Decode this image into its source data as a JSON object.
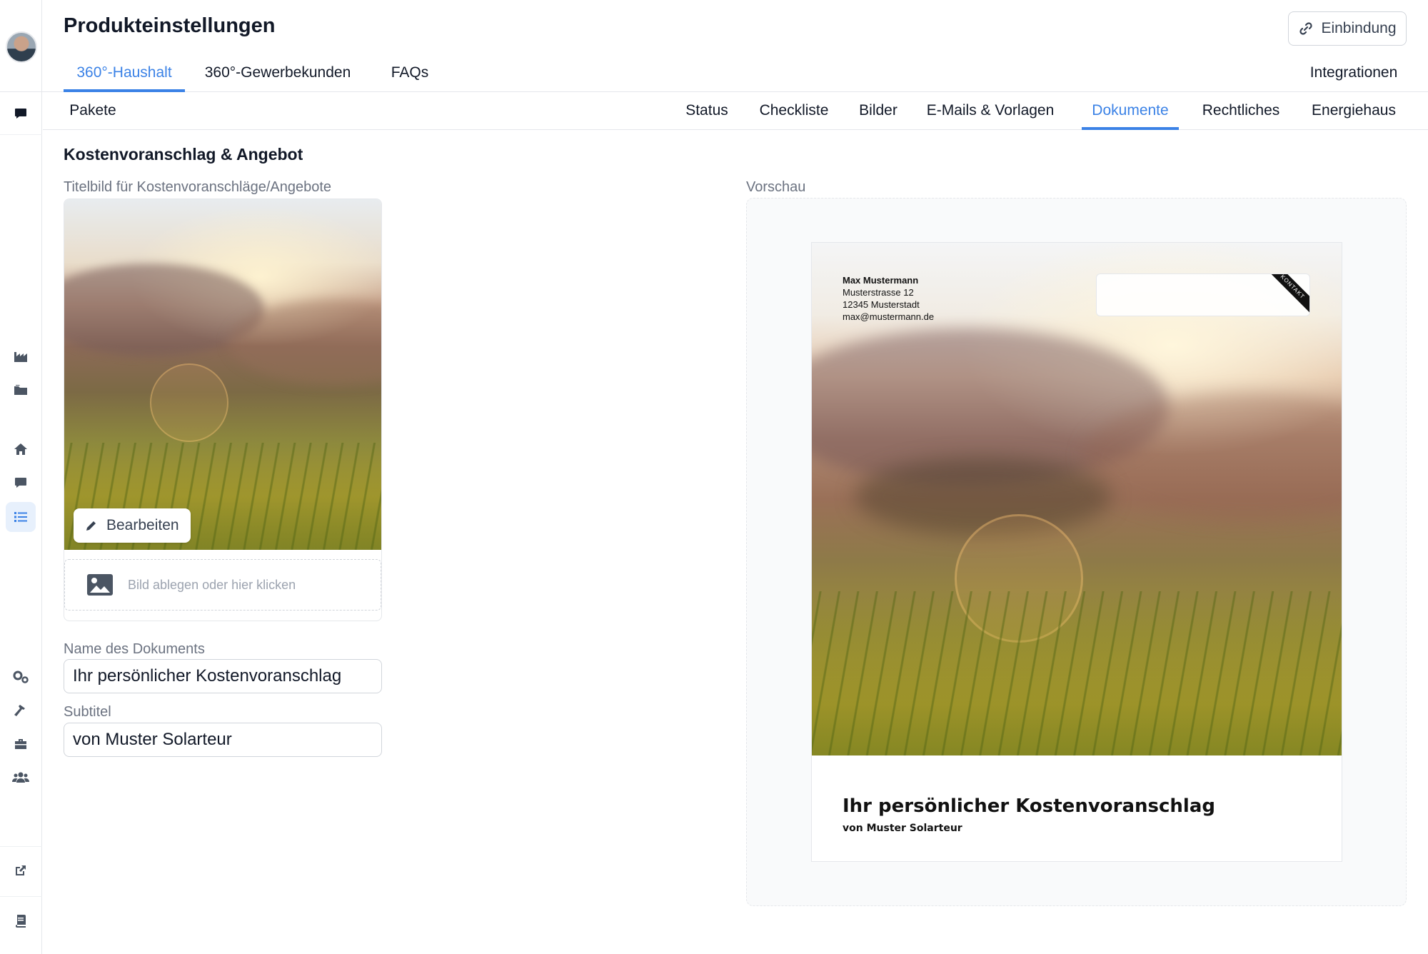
{
  "header": {
    "title": "Produkteinstellungen",
    "embed_button_label": "Einbindung"
  },
  "tabs_primary": [
    {
      "label": "360°-Haushalt",
      "active": true
    },
    {
      "label": "360°-Gewerbekunden",
      "active": false
    },
    {
      "label": "FAQs",
      "active": false
    },
    {
      "label": "Integrationen",
      "active": false
    }
  ],
  "tabs_secondary": [
    {
      "label": "Pakete",
      "active": false
    },
    {
      "label": "Status",
      "active": false
    },
    {
      "label": "Checkliste",
      "active": false
    },
    {
      "label": "Bilder",
      "active": false
    },
    {
      "label": "E-Mails & Vorlagen",
      "active": false
    },
    {
      "label": "Dokumente",
      "active": true
    },
    {
      "label": "Rechtliches",
      "active": false
    },
    {
      "label": "Energiehaus",
      "active": false
    }
  ],
  "sidebar": {
    "items": [
      {
        "icon": "chat-icon",
        "active": false
      },
      {
        "icon": "factory-icon",
        "active": false
      },
      {
        "icon": "folder-icon",
        "active": false
      },
      {
        "icon": "home-icon",
        "active": false
      },
      {
        "icon": "message-icon",
        "active": false
      },
      {
        "icon": "list-icon",
        "active": true
      },
      {
        "icon": "gears-icon",
        "active": false
      },
      {
        "icon": "hammer-icon",
        "active": false
      },
      {
        "icon": "toolbox-icon",
        "active": false
      },
      {
        "icon": "users-icon",
        "active": false
      },
      {
        "icon": "external-link-icon",
        "active": false
      },
      {
        "icon": "book-icon",
        "active": false
      }
    ]
  },
  "section": {
    "title": "Kostenvoranschlag & Angebot",
    "cover_image_label": "Titelbild für Kostenvoranschläge/Angebote",
    "edit_button_label": "Bearbeiten",
    "dropzone_text": "Bild ablegen oder hier klicken",
    "doc_name_label": "Name des Dokuments",
    "doc_name_value": "Ihr persönlicher Kostenvoranschlag",
    "subtitle_label": "Subtitel",
    "subtitle_value": "von Muster Solarteur"
  },
  "preview": {
    "label": "Vorschau",
    "address_name": "Max Mustermann",
    "address_street": "Musterstrasse 12",
    "address_city": "12345 Musterstadt",
    "address_email": "max@mustermann.de",
    "ribbon_text": "KONTAKT",
    "title": "Ihr persönlicher Kostenvoranschlag",
    "subtitle": "von Muster Solarteur"
  },
  "colors": {
    "accent": "#3b82e6",
    "text": "#111827",
    "muted": "#6b7280",
    "border": "#e5e7eb",
    "sidebar_icon": "#374151",
    "active_bg": "#e7f0fc"
  }
}
